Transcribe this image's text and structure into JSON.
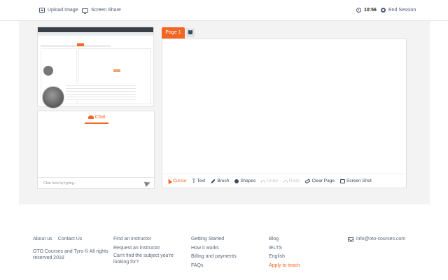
{
  "topbar": {
    "upload_label": "Upload Image",
    "screen_share_label": "Screen Share",
    "timer": "10:56",
    "end_session_label": "End Session"
  },
  "chat": {
    "tab_label": "Chat",
    "input_placeholder": "Chat here by typing..."
  },
  "board": {
    "page_tab": "Page 1",
    "tools": {
      "cursor": "Cursor",
      "text": "Text",
      "brush": "Brush",
      "shapes": "Shapes",
      "undo": "Undo",
      "redo": "Redo",
      "clear_page": "Clear Page",
      "screen_shot": "Screen Shot"
    }
  },
  "footer": {
    "about": "About us",
    "contact": "Contact Us",
    "copyright": "OTO Courses and Tyro © All rights reserved 2018",
    "col2": [
      "Find an instructor",
      "Request an instructor",
      "Can't find the subject you're looking for?"
    ],
    "col3": [
      "Getting Started",
      "How it works",
      "Billing and payments",
      "FAQs"
    ],
    "col4": [
      "Blog",
      "IELTS",
      "English",
      "Apply to teach"
    ],
    "email": "info@oto-courses.com"
  },
  "colors": {
    "accent": "#f26522",
    "nav_text": "#4a5a7a"
  }
}
